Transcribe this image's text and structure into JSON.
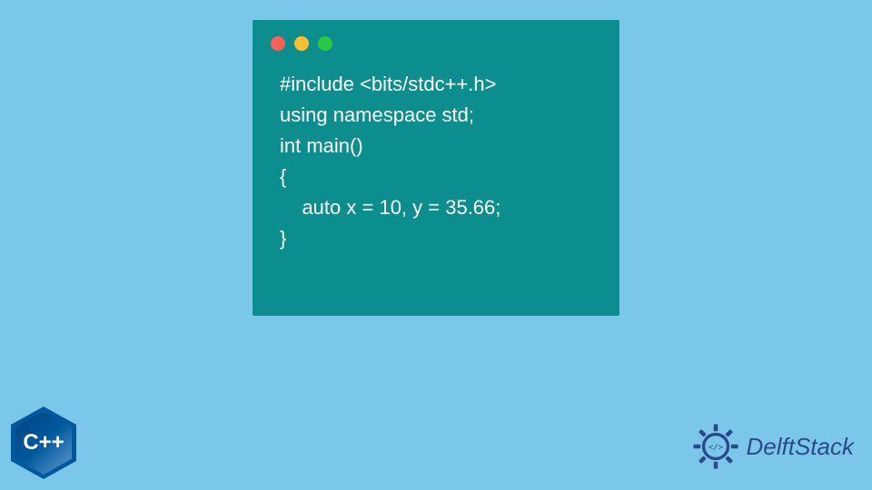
{
  "code": {
    "lines": [
      "#include <bits/stdc++.h>",
      "using namespace std;",
      "",
      "int main()",
      "{",
      "    auto x = 10, y = 35.66;",
      "}"
    ]
  },
  "badges": {
    "cpp": "C++",
    "delft": "DelftStack"
  }
}
